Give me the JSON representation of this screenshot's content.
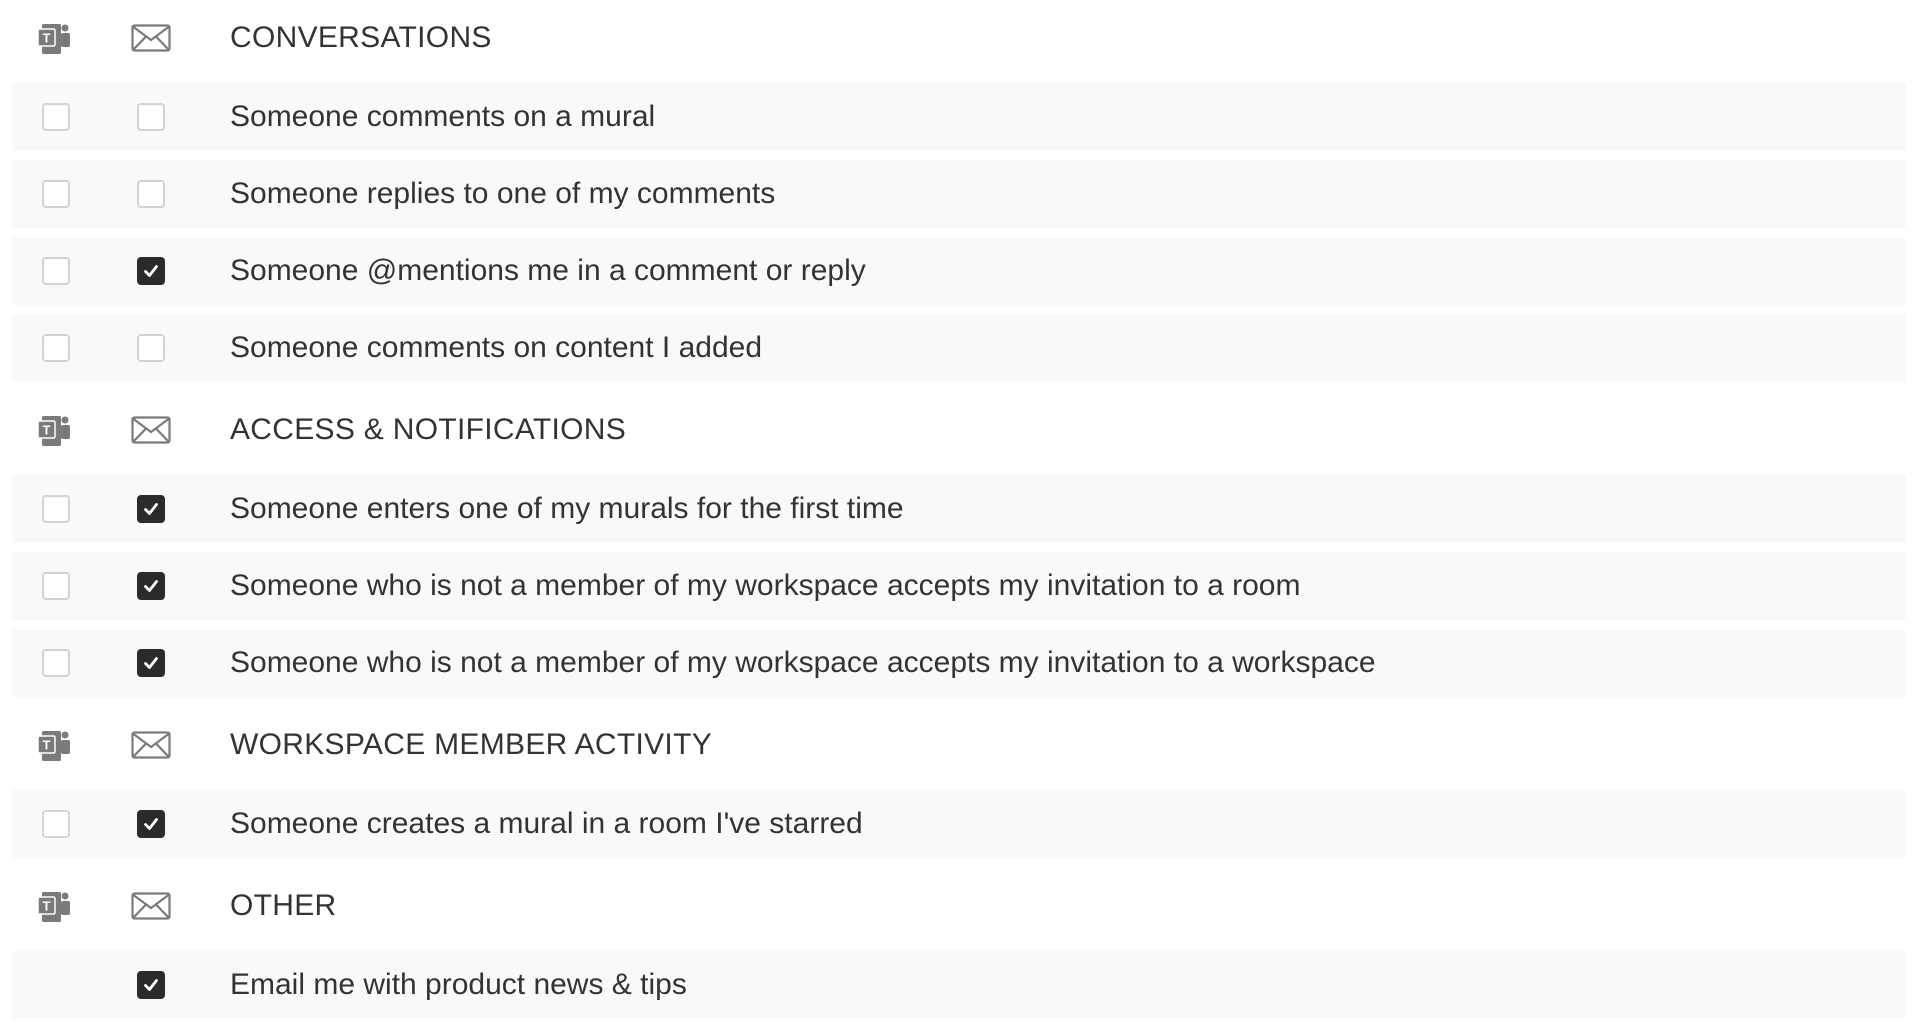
{
  "columns": {
    "teams_icon": "teams-icon",
    "email_icon": "envelope-icon"
  },
  "colors": {
    "row_background": "#f9f9f9",
    "checkbox_checked": "#2b2b2b",
    "checkbox_border": "#d2d2d2",
    "text": "#333333",
    "icon": "#7a7a7a"
  },
  "sections": [
    {
      "title": "CONVERSATIONS",
      "items": [
        {
          "label": "Someone comments on a mural",
          "teams": false,
          "email": false
        },
        {
          "label": "Someone replies to one of my comments",
          "teams": false,
          "email": false
        },
        {
          "label": "Someone @mentions me in a comment or reply",
          "teams": false,
          "email": true
        },
        {
          "label": "Someone comments on content I added",
          "teams": false,
          "email": false
        }
      ]
    },
    {
      "title": "ACCESS & NOTIFICATIONS",
      "items": [
        {
          "label": "Someone enters one of my murals for the first time",
          "teams": false,
          "email": true
        },
        {
          "label": "Someone who is not a member of my workspace accepts my invitation to a room",
          "teams": false,
          "email": true
        },
        {
          "label": "Someone who is not a member of my workspace accepts my invitation to a workspace",
          "teams": false,
          "email": true
        }
      ]
    },
    {
      "title": "WORKSPACE MEMBER ACTIVITY",
      "items": [
        {
          "label": "Someone creates a mural in a room I've starred",
          "teams": false,
          "email": true
        }
      ]
    },
    {
      "title": "OTHER",
      "items": [
        {
          "label": "Email me with product news & tips",
          "teams": null,
          "email": true
        }
      ]
    }
  ]
}
